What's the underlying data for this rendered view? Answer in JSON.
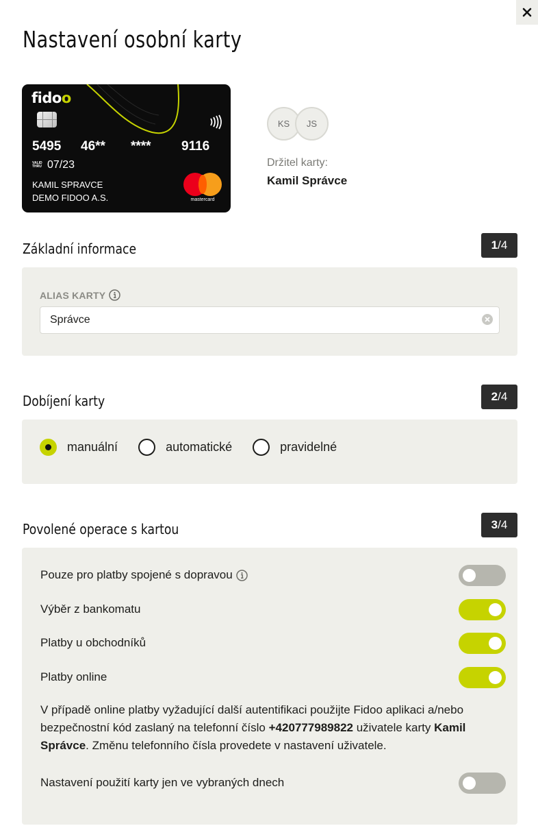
{
  "page": {
    "title": "Nastavení osobní karty"
  },
  "card": {
    "brand_logo": "fidoo",
    "number_groups": [
      "5495",
      "46**",
      "****",
      "9116"
    ],
    "valid_label": "VALID THRU",
    "valid_thru": "07/23",
    "holder_name_line": "KAMIL SPRAVCE",
    "company_line": "DEMO FIDOO A.S.",
    "network": "mastercard",
    "accent_color": "#c6d300"
  },
  "holder": {
    "avatars": [
      "KS",
      "JS"
    ],
    "label": "Držitel karty:",
    "name": "Kamil Správce"
  },
  "sections": {
    "basic": {
      "title": "Základní informace",
      "step_current": "1",
      "step_total": "/4",
      "alias_label": "ALIAS KARTY",
      "alias_value": "Správce"
    },
    "topup": {
      "title": "Dobíjení karty",
      "step_current": "2",
      "step_total": "/4",
      "options": [
        "manuální",
        "automatické",
        "pravidelné"
      ],
      "selected": "manuální"
    },
    "operations": {
      "title": "Povolené operace s kartou",
      "step_current": "3",
      "step_total": "/4",
      "items": [
        {
          "label": "Pouze pro platby spojené s dopravou",
          "enabled": false
        },
        {
          "label": "Výběr z bankomatu",
          "enabled": true
        },
        {
          "label": "Platby u obchodníků",
          "enabled": true
        },
        {
          "label": "Platby online",
          "enabled": true
        }
      ],
      "note_part1": "V případě online platby vyžadující další autentifikaci použijte Fidoo aplikaci a/nebo bezpečnostní kód zaslaný na telefonní číslo ",
      "note_phone": "+420777989822",
      "note_part2": " uživatele karty ",
      "note_user": "Kamil Správce",
      "note_part3": ". Změnu telefonního čísla provedete v nastavení uživatele.",
      "days_label": "Nastavení použití karty jen ve vybraných dnech",
      "days_enabled": false
    }
  }
}
